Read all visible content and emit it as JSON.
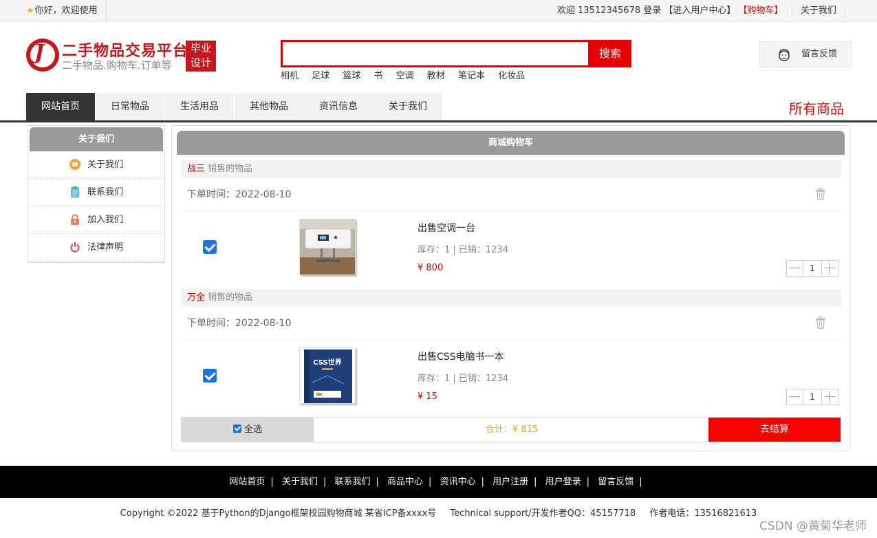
{
  "topbar": {
    "welcome_left": "你好，欢迎使用",
    "welcome_right": "欢迎 13512345678 登录",
    "user_center": "【进入用户中心】",
    "cart": "【购物车】",
    "about": "关于我们"
  },
  "header": {
    "title": "二手物品交易平台",
    "subtitle": "二手物品.购物车.订单等",
    "badge_line1": "毕业",
    "badge_line2": "设计",
    "search_button": "搜索",
    "search_value": "",
    "hotwords": [
      "相机",
      "足球",
      "篮球",
      "书",
      "空调",
      "教材",
      "笔记本",
      "化妆品"
    ],
    "feedback": "留言反馈"
  },
  "nav": {
    "items": [
      "网站首页",
      "日常物品",
      "生活用品",
      "其他物品",
      "资讯信息",
      "关于我们"
    ],
    "active_index": 0,
    "all_goods": "所有商品"
  },
  "sidebar": {
    "title": "关于我们",
    "items": [
      {
        "label": "关于我们",
        "icon": "folder-icon",
        "color": "#f4a23b"
      },
      {
        "label": "联系我们",
        "icon": "clipboard-icon",
        "color": "#5bc0de"
      },
      {
        "label": "加入我们",
        "icon": "lock-icon",
        "color": "#d9835f"
      },
      {
        "label": "法律声明",
        "icon": "power-icon",
        "color": "#c0504d"
      }
    ]
  },
  "cart": {
    "title": "商城购物车",
    "groups": [
      {
        "seller": "战三",
        "seller_suffix": "销售的物品",
        "order_time": "下单时间：2022-08-10",
        "item": {
          "checked": true,
          "title": "出售空调一台",
          "stock": "库存：1 | 已销：1234",
          "price": "¥ 800",
          "qty": "1",
          "image": "water-heater-image"
        }
      },
      {
        "seller": "万全",
        "seller_suffix": "销售的物品",
        "order_time": "下单时间：2022-08-10",
        "item": {
          "checked": true,
          "title": "出售CSS电脑书一本",
          "stock": "库存：1 | 已销：1234",
          "price": "¥ 15",
          "qty": "1",
          "image": "css-book-image",
          "book_title": "CSS世界"
        }
      }
    ],
    "select_all": "全选",
    "total": "合计：¥ 815",
    "checkout": "去结算"
  },
  "footer": {
    "links": [
      "网站首页",
      "关于我们",
      "联系我们",
      "商品中心",
      "资讯中心",
      "用户注册",
      "用户登录",
      "留言反馈"
    ],
    "copyright": "Copyright ©2022 基于Python的Django框架校园购物商城 某省ICP备xxxx号",
    "support": "Technical support/开发作者QQ：45157718",
    "phone": "作者电话：13516821613"
  },
  "watermark": "CSDN @黄菊华老师",
  "colors": {
    "brand_red": "#c8161d",
    "accent_red": "#e60000",
    "nav_active": "#333333",
    "checkbox_blue": "#1a73e8",
    "total_orange": "#f0a020"
  }
}
